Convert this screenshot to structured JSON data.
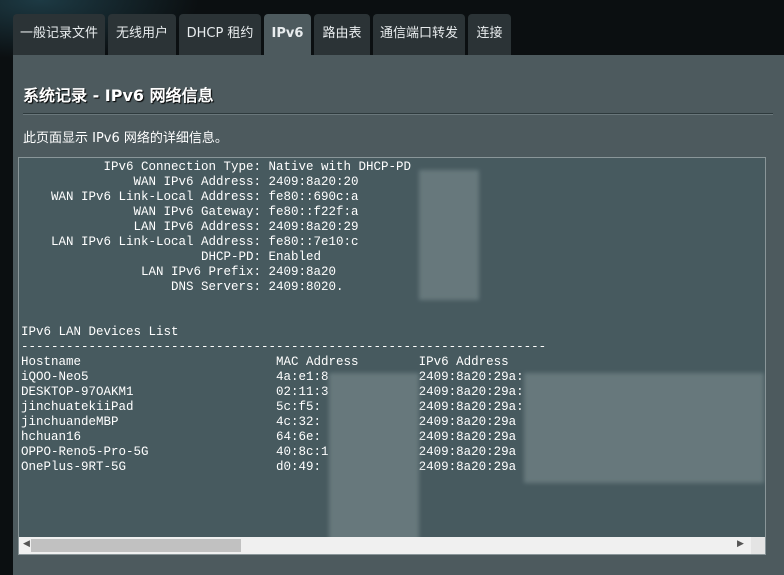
{
  "tabs": [
    {
      "label": "一般记录文件",
      "active": false
    },
    {
      "label": "无线用户",
      "active": false
    },
    {
      "label": "DHCP 租约",
      "active": false
    },
    {
      "label": "IPv6",
      "active": true
    },
    {
      "label": "路由表",
      "active": false
    },
    {
      "label": "通信端口转发",
      "active": false
    },
    {
      "label": "连接",
      "active": false
    }
  ],
  "page": {
    "title": "系统记录 - IPv6 网络信息",
    "description": "此页面显示 IPv6 网络的详细信息。"
  },
  "info": [
    {
      "label": "IPv6 Connection Type:",
      "value": "Native with DHCP-PD"
    },
    {
      "label": "WAN IPv6 Address:",
      "value": "2409:8a20:20"
    },
    {
      "label": "WAN IPv6 Link-Local Address:",
      "value": "fe80::690c:a"
    },
    {
      "label": "WAN IPv6 Gateway:",
      "value": "fe80::f22f:a"
    },
    {
      "label": "LAN IPv6 Address:",
      "value": "2409:8a20:29"
    },
    {
      "label": "LAN IPv6 Link-Local Address:",
      "value": "fe80::7e10:c"
    },
    {
      "label": "DHCP-PD:",
      "value": "Enabled"
    },
    {
      "label": "LAN IPv6 Prefix:",
      "value": "2409:8a20"
    },
    {
      "label": "DNS Servers:",
      "value": "2409:8020."
    }
  ],
  "devices": {
    "title": "IPv6 LAN Devices List",
    "separator": "----------------------------------------------------------------------",
    "headers": [
      "Hostname",
      "MAC Address",
      "IPv6 Address"
    ],
    "rows": [
      [
        "iQOO-Neo5",
        "4a:e1:8",
        "2409:8a20:29a:"
      ],
      [
        "DESKTOP-97OAKM1",
        "02:11:3",
        "2409:8a20:29a:"
      ],
      [
        "jinchuatekiiPad",
        "5c:f5:",
        "2409:8a20:29a:"
      ],
      [
        "jinchuandeMBP",
        "4c:32:",
        "2409:8a20:29a"
      ],
      [
        "hchuan16",
        "64:6e:",
        "2409:8a20:29a"
      ],
      [
        "OPPO-Reno5-Pro-5G",
        "40:8c:1",
        "2409:8a20:29a"
      ],
      [
        "OnePlus-9RT-5G",
        "d0:49:",
        "2409:8a20:29a"
      ]
    ]
  }
}
